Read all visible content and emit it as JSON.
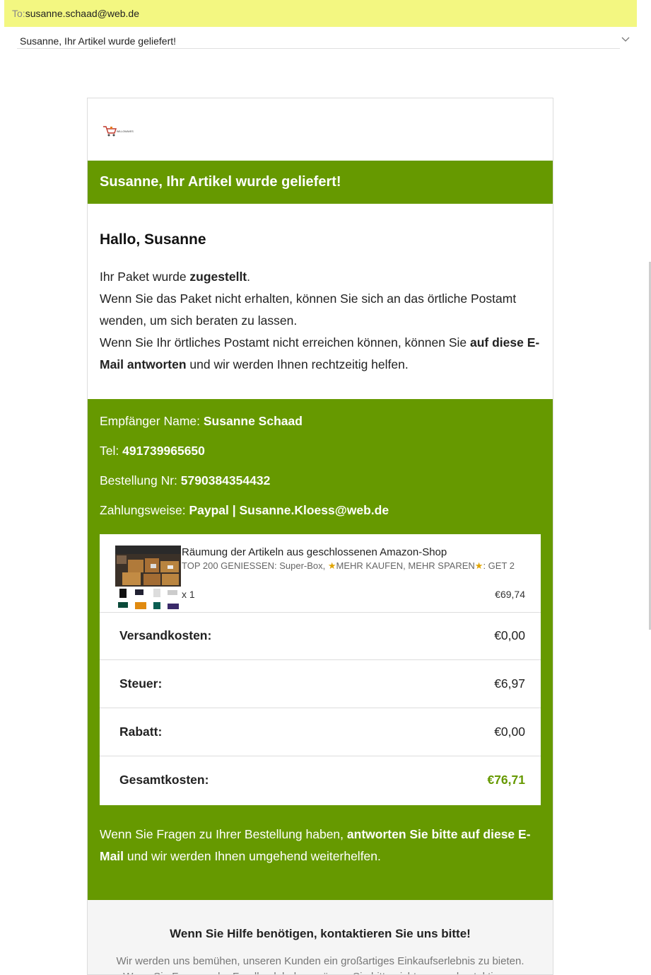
{
  "header": {
    "to_label": "To:",
    "to_value": "susanne.schaad@web.de",
    "subject": "Susanne, Ihr Artikel wurde geliefert!"
  },
  "email": {
    "logo_text": "WILLOWAVES",
    "banner_title": "Susanne, Ihr Artikel wurde geliefert!",
    "greeting": "Hallo, Susanne",
    "intro": {
      "l1_pre": "Ihr Paket wurde ",
      "l1_bold": "zugestellt",
      "l1_post": ".",
      "l2": "Wenn Sie das Paket nicht erhalten, können Sie sich an das örtliche Postamt wenden, um sich beraten zu lassen.",
      "l3_pre": "Wenn Sie Ihr örtliches Postamt nicht erreichen können, können Sie ",
      "l3_bold": "auf diese E-Mail antworten",
      "l3_post": " und wir werden Ihnen rechtzeitig helfen."
    },
    "info": {
      "recipient_label": "Empfänger Name: ",
      "recipient_value": "Susanne Schaad",
      "tel_label": "Tel: ",
      "tel_value": "491739965650",
      "order_label": "Bestellung Nr: ",
      "order_value": "5790384354432",
      "payment_label": "Zahlungsweise: ",
      "payment_value": "Paypal | Susanne.Kloess@web.de"
    },
    "product": {
      "title": "Räumung der Artikeln aus geschlossenen Amazon-Shop",
      "sub_a": "TOP 200 GENIESSEN: Super-Box, ",
      "star_icon": "star-icon",
      "sub_b": "MEHR KAUFEN, MEHR SPAREN",
      "sub_c": ": GET 2",
      "qty": "x 1",
      "price": "€69,74"
    },
    "summary": [
      {
        "label": "Versandkosten:",
        "value": "€0,00"
      },
      {
        "label": "Steuer:",
        "value": "€6,97"
      },
      {
        "label": "Rabatt:",
        "value": "€0,00"
      },
      {
        "label": "Gesamtkosten:",
        "value": "€76,71"
      }
    ],
    "outro": {
      "pre": "Wenn Sie Fragen zu Ihrer Bestellung haben, ",
      "bold": "antworten Sie bitte auf diese E-Mail",
      "post": " und wir werden Ihnen umgehend weiterhelfen."
    },
    "footer": {
      "title": "Wenn Sie Hilfe benötigen, kontaktieren Sie uns bitte!",
      "line1": "Wir werden uns bemühen, unseren Kunden ein großartiges Einkaufserlebnis zu bieten.",
      "line2": "Wenn Sie Fragen oder Feedback haben, zögern Sie bitte nicht, uns zu kontaktieren."
    },
    "colors": {
      "accent": "#669900",
      "to_bar": "#f3f781",
      "star": "#e0a400"
    }
  }
}
